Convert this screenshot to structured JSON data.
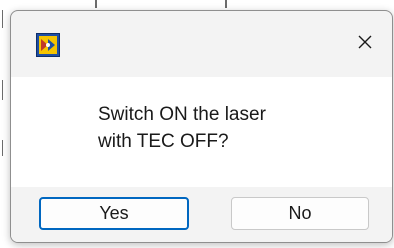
{
  "dialog": {
    "app_icon": "labview-app-icon",
    "close_icon": "close-icon",
    "message": "Switch ON the laser\nwith TEC OFF?",
    "buttons": {
      "yes_label": "Yes",
      "no_label": "No",
      "default": "Yes"
    }
  },
  "colors": {
    "accent": "#0067c0",
    "icon_yellow": "#f5c400",
    "icon_blue": "#1f4fa3",
    "dialog_bg": "#f3f3f3",
    "content_bg": "#ffffff"
  }
}
